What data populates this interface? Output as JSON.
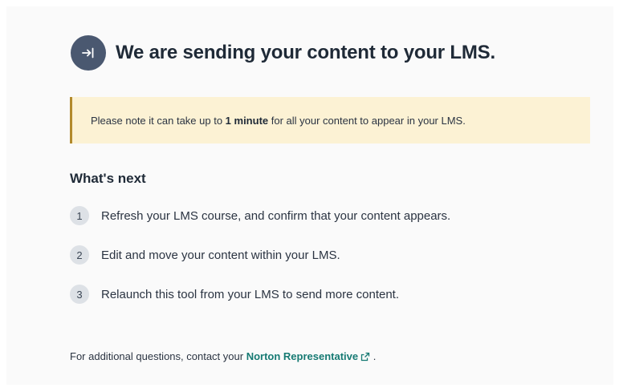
{
  "header": {
    "icon": "sign-in-arrow-icon",
    "title": "We are sending your content to your LMS."
  },
  "notice": {
    "before": "Please note it can take up to ",
    "bold": "1 minute",
    "after": " for all your content to appear in your LMS."
  },
  "next": {
    "heading": "What's next",
    "steps": [
      {
        "number": "1",
        "text": "Refresh your LMS course, and confirm that your content appears."
      },
      {
        "number": "2",
        "text": "Edit and move your content within your LMS."
      },
      {
        "number": "3",
        "text": "Relaunch this tool from your LMS to send more content."
      }
    ]
  },
  "footer": {
    "prefix": "For additional questions, contact your ",
    "link_label": "Norton Representative",
    "link_icon": "external-link-icon",
    "suffix": " ."
  },
  "colors": {
    "icon_circle": "#4a5870",
    "notice_bg": "#fcf2d4",
    "notice_border": "#b28a2c",
    "link": "#167a73"
  }
}
